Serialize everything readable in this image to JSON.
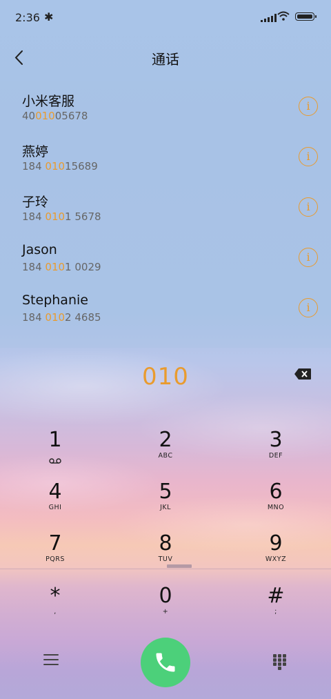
{
  "status_bar": {
    "time": "2:36",
    "bluetooth_icon": "bluetooth-icon",
    "signal_icon": "signal-icon",
    "wifi_icon": "wifi-icon",
    "battery_icon": "battery-icon"
  },
  "header": {
    "back_icon": "back-chevron-icon",
    "title": "通话"
  },
  "results": [
    {
      "name": "小米客服",
      "num_pre": "40",
      "num_hl": "010",
      "num_post": "05678"
    },
    {
      "name": "燕婷",
      "num_pre": "184 ",
      "num_hl": "010",
      "num_post": "15689"
    },
    {
      "name": "子玲",
      "num_pre": "184 ",
      "num_hl": "010",
      "num_post": "1 5678"
    },
    {
      "name": "Jason",
      "num_pre": "184 ",
      "num_hl": "010",
      "num_post": "1 0029"
    },
    {
      "name": "Stephanie",
      "num_pre": "184 ",
      "num_hl": "010",
      "num_post": "2 4685"
    }
  ],
  "info_glyph": "i",
  "dial": {
    "entered": "010",
    "backspace_icon": "backspace-icon"
  },
  "keypad": [
    {
      "digit": "1",
      "letters": ""
    },
    {
      "digit": "2",
      "letters": "ABC"
    },
    {
      "digit": "3",
      "letters": "DEF"
    },
    {
      "digit": "4",
      "letters": "GHI"
    },
    {
      "digit": "5",
      "letters": "JKL"
    },
    {
      "digit": "6",
      "letters": "MNO"
    },
    {
      "digit": "7",
      "letters": "PQRS"
    },
    {
      "digit": "8",
      "letters": "TUV"
    },
    {
      "digit": "9",
      "letters": "WXYZ"
    },
    {
      "digit": "*",
      "letters": ","
    },
    {
      "digit": "0",
      "letters": "+"
    },
    {
      "digit": "#",
      "letters": ";"
    }
  ],
  "bottom_bar": {
    "menu_icon": "menu-icon",
    "call_icon": "phone-icon",
    "keypad_toggle_icon": "dialpad-icon"
  },
  "colors": {
    "accent": "#e99b2e",
    "call_button": "#4cd07a"
  }
}
